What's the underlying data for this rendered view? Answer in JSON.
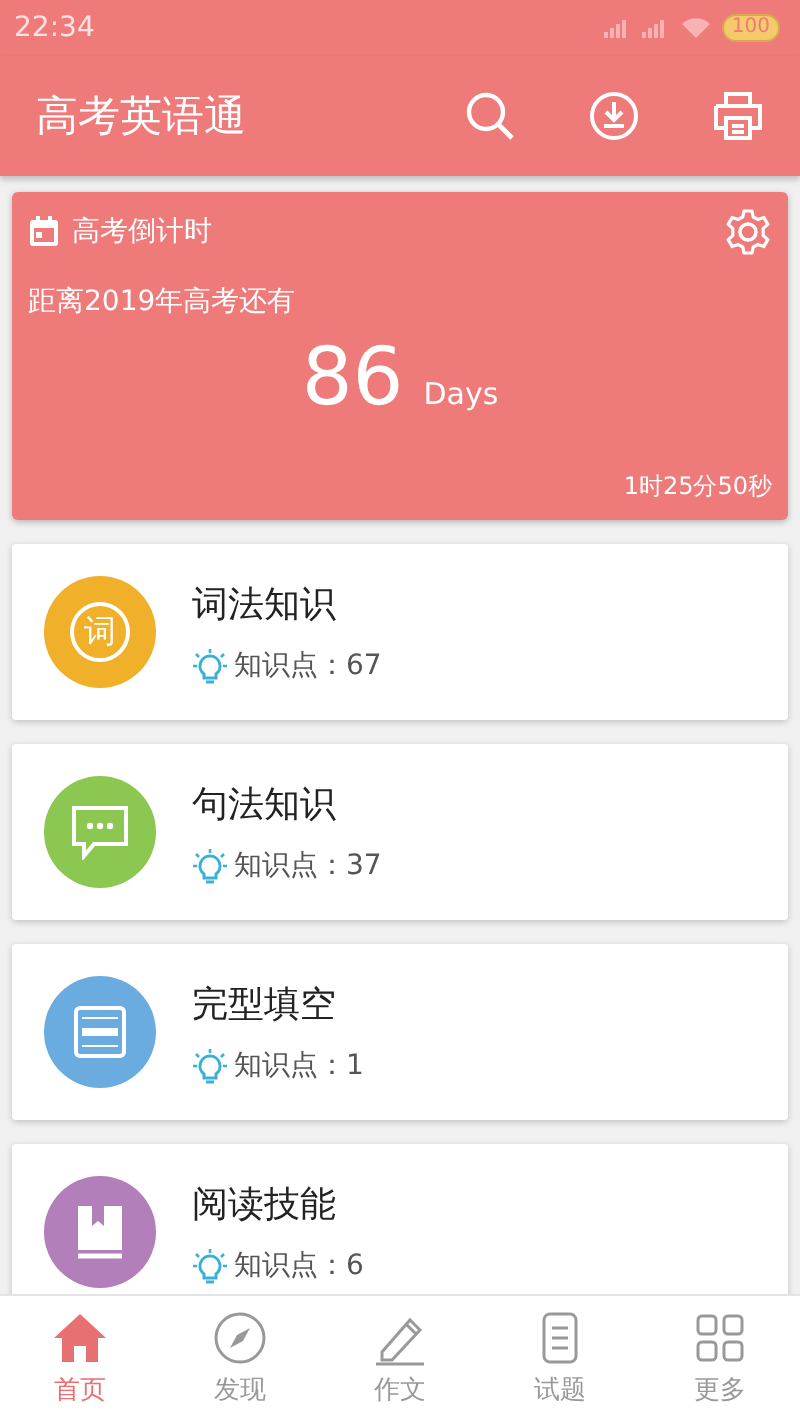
{
  "status_bar": {
    "time": "22:34",
    "battery": "100"
  },
  "app_bar": {
    "title": "高考英语通"
  },
  "countdown": {
    "title": "高考倒计时",
    "subtitle": "距离2019年高考还有",
    "number": "86",
    "unit": "Days",
    "remaining": "1时25分50秒"
  },
  "topics": [
    {
      "kind": "word",
      "icon_char": "词",
      "title": "词法知识",
      "count_label": "知识点：67",
      "color": "#f0b02a"
    },
    {
      "kind": "chat",
      "title": "句法知识",
      "count_label": "知识点：37",
      "color": "#8cc751"
    },
    {
      "kind": "form",
      "title": "完型填空",
      "count_label": "知识点：1",
      "color": "#6aace0"
    },
    {
      "kind": "book",
      "title": "阅读技能",
      "count_label": "知识点：6",
      "color": "#b37fba"
    }
  ],
  "bottom_nav": [
    {
      "kind": "home",
      "label": "首页",
      "selected": true
    },
    {
      "kind": "compass",
      "label": "发现",
      "selected": false
    },
    {
      "kind": "pencil",
      "label": "作文",
      "selected": false
    },
    {
      "kind": "list",
      "label": "试题",
      "selected": false
    },
    {
      "kind": "grid",
      "label": "更多",
      "selected": false
    }
  ]
}
